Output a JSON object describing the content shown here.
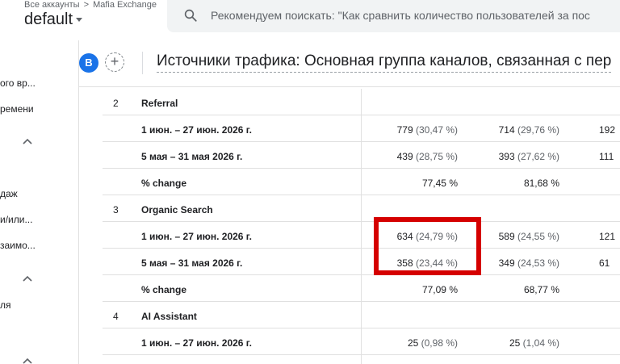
{
  "header": {
    "breadcrumb_root": "Все аккаунты",
    "breadcrumb_sep": ">",
    "breadcrumb_account": "Mafia Exchange",
    "property": "default",
    "search_placeholder": "Рекомендуем поискать: \"Как сравнить количество пользователей за пос"
  },
  "sidebar": {
    "items": [
      "ого вр...",
      "ремени",
      "даж",
      "и/или...",
      "заимо...",
      "ля"
    ]
  },
  "report": {
    "avatar_letter": "B",
    "add_label": "+",
    "title": "Источники трафика: Основная группа каналов, связанная с пер"
  },
  "table": {
    "rows": [
      {
        "num": "2",
        "label": "Referral",
        "v1": "",
        "v1pct": "",
        "v2": "",
        "v2pct": "",
        "v3": ""
      },
      {
        "num": "",
        "label": "1 июн. – 27 июн. 2026 г.",
        "v1": "779",
        "v1pct": "(30,47 %)",
        "v2": "714",
        "v2pct": "(29,76 %)",
        "v3": "192"
      },
      {
        "num": "",
        "label": "5 мая – 31 мая 2026 г.",
        "v1": "439",
        "v1pct": "(28,75 %)",
        "v2": "393",
        "v2pct": "(27,62 %)",
        "v3": "111"
      },
      {
        "num": "",
        "label": "% change",
        "v1": "77,45 %",
        "v1pct": "",
        "v2": "81,68 %",
        "v2pct": "",
        "v3": ""
      },
      {
        "num": "3",
        "label": "Organic Search",
        "v1": "",
        "v1pct": "",
        "v2": "",
        "v2pct": "",
        "v3": ""
      },
      {
        "num": "",
        "label": "1 июн. – 27 июн. 2026 г.",
        "v1": "634",
        "v1pct": "(24,79 %)",
        "v2": "589",
        "v2pct": "(24,55 %)",
        "v3": "121"
      },
      {
        "num": "",
        "label": "5 мая – 31 мая 2026 г.",
        "v1": "358",
        "v1pct": "(23,44 %)",
        "v2": "349",
        "v2pct": "(24,53 %)",
        "v3": "61"
      },
      {
        "num": "",
        "label": "% change",
        "v1": "77,09 %",
        "v1pct": "",
        "v2": "68,77 %",
        "v2pct": "",
        "v3": ""
      },
      {
        "num": "4",
        "label": "AI Assistant",
        "v1": "",
        "v1pct": "",
        "v2": "",
        "v2pct": "",
        "v3": ""
      },
      {
        "num": "",
        "label": "1 июн. – 27 июн. 2026 г.",
        "v1": "25",
        "v1pct": "(0,98 %)",
        "v2": "25",
        "v2pct": "(1,04 %)",
        "v3": ""
      }
    ]
  },
  "colors": {
    "highlight": "#d50000",
    "accent": "#1a73e8"
  }
}
